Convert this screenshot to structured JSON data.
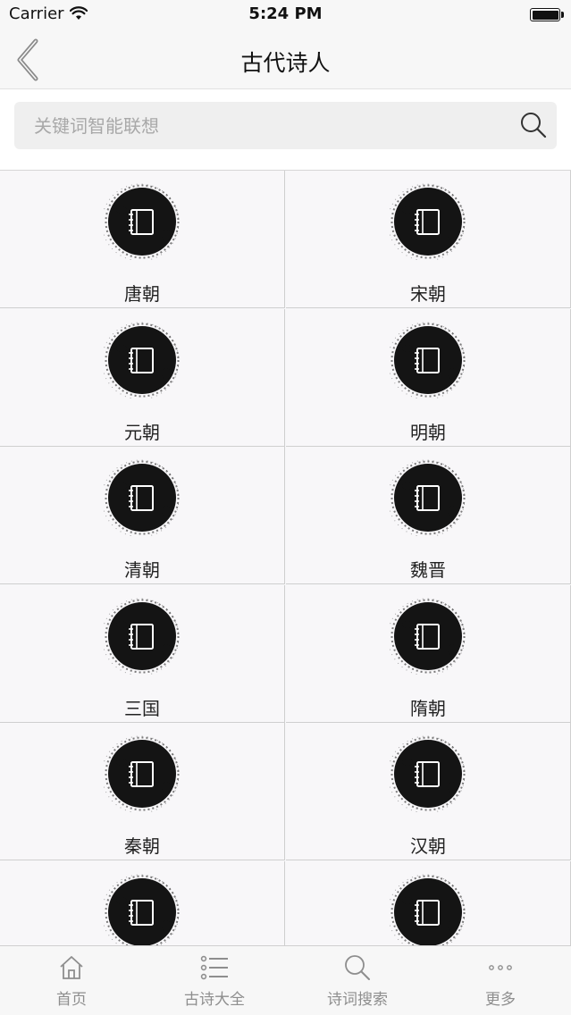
{
  "status_bar": {
    "carrier": "Carrier",
    "time": "5:24 PM",
    "battery_level": 1.0
  },
  "nav": {
    "title": "古代诗人",
    "back_icon": "chevron-left-icon"
  },
  "search": {
    "placeholder": "关键词智能联想",
    "value": "",
    "icon": "search-icon"
  },
  "grid": {
    "item_icon": "notebook-ink-icon",
    "items": [
      {
        "label": "唐朝"
      },
      {
        "label": "宋朝"
      },
      {
        "label": "元朝"
      },
      {
        "label": "明朝"
      },
      {
        "label": "清朝"
      },
      {
        "label": "魏晋"
      },
      {
        "label": "三国"
      },
      {
        "label": "隋朝"
      },
      {
        "label": "秦朝"
      },
      {
        "label": "汉朝"
      },
      {
        "label": ""
      },
      {
        "label": ""
      }
    ]
  },
  "tabs": [
    {
      "label": "首页",
      "icon": "home-icon"
    },
    {
      "label": "古诗大全",
      "icon": "list-icon"
    },
    {
      "label": "诗词搜索",
      "icon": "search-icon"
    },
    {
      "label": "更多",
      "icon": "more-icon"
    }
  ],
  "colors": {
    "ink": "#141414",
    "tab_inactive": "#8e8e8e",
    "background": "#f8f7f9"
  }
}
